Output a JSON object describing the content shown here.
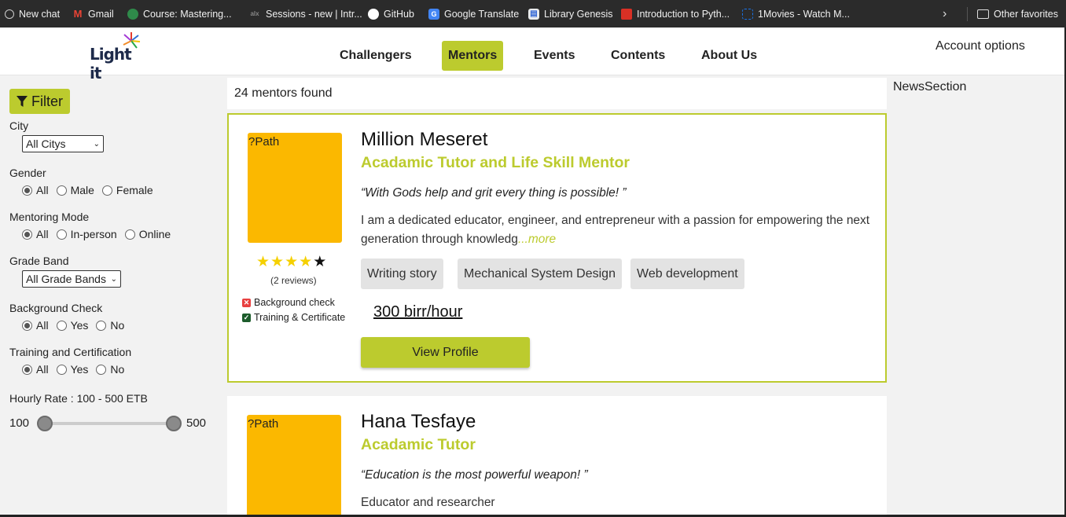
{
  "bookmarks": [
    {
      "label": "New chat",
      "icon": "openai-icon",
      "color": "#cccccc"
    },
    {
      "label": "Gmail",
      "icon": "gmail-icon",
      "color": "#ea4335"
    },
    {
      "label": "Course: Mastering...",
      "icon": "course-icon",
      "color": "#2f8a4a"
    },
    {
      "label": "Sessions - new | Intr...",
      "icon": "alx-icon",
      "color": "#444444"
    },
    {
      "label": "GitHub",
      "icon": "github-icon",
      "color": "#ffffff"
    },
    {
      "label": "Google Translate",
      "icon": "translate-icon",
      "color": "#4285f4"
    },
    {
      "label": "Library Genesis",
      "icon": "library-icon",
      "color": "#3367d6"
    },
    {
      "label": "Introduction to Pyth...",
      "icon": "book-icon",
      "color": "#d93025"
    },
    {
      "label": "1Movies - Watch M...",
      "icon": "movie-icon",
      "color": "#1a73e8"
    }
  ],
  "other_favorites": "Other favorites",
  "header": {
    "logo_text": "Light it",
    "nav": [
      "Challengers",
      "Mentors",
      "Events",
      "Contents",
      "About Us"
    ],
    "active_nav": "Mentors",
    "account": "Account options"
  },
  "filters": {
    "button": "Filter",
    "city": {
      "label": "City",
      "value": "All Citys"
    },
    "gender": {
      "label": "Gender",
      "options": [
        "All",
        "Male",
        "Female"
      ],
      "selected": "All"
    },
    "mode": {
      "label": "Mentoring Mode",
      "options": [
        "All",
        "In-person",
        "Online"
      ],
      "selected": "All"
    },
    "grade": {
      "label": "Grade Band",
      "value": "All Grade Bands"
    },
    "background": {
      "label": "Background Check",
      "options": [
        "All",
        "Yes",
        "No"
      ],
      "selected": "All"
    },
    "training": {
      "label": "Training and Certification",
      "options": [
        "All",
        "Yes",
        "No"
      ],
      "selected": "All"
    },
    "rate": {
      "label": "Hourly Rate : 100 - 500 ETB",
      "min": "100",
      "max": "500"
    }
  },
  "results_count": "24 mentors found",
  "mentors": [
    {
      "photo_alt": "?Path",
      "name": "Million Meseret",
      "title": "Acadamic Tutor and Life Skill Mentor",
      "quote": "“With Gods help and grit every thing is possible! ”",
      "bio": "I am a dedicated educator, engineer, and entrepreneur with a passion for empowering the next generation through knowledg",
      "more": "...more",
      "rating": 4,
      "reviews": "(2 reviews)",
      "background_check": "Background check",
      "training": "Training & Certificate",
      "tags": [
        "Writing story",
        "Mechanical System Design",
        "Web development"
      ],
      "rate": "300 birr/hour",
      "button": "View Profile"
    },
    {
      "photo_alt": "?Path",
      "name": "Hana Tesfaye",
      "title": "Acadamic Tutor",
      "quote": "“Education is the most powerful weapon! ”",
      "bio": "Educator and researcher"
    }
  ],
  "news": "NewsSection"
}
